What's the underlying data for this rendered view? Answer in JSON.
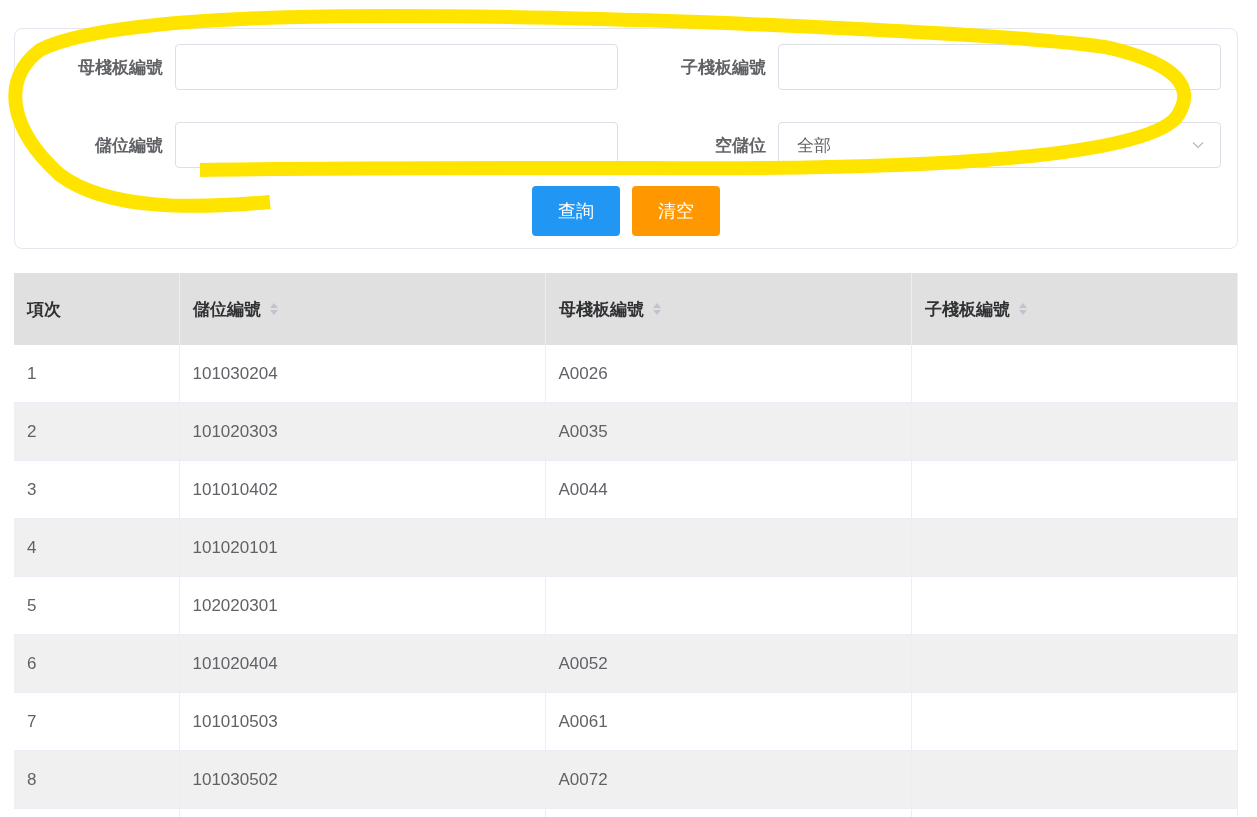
{
  "filters": [
    {
      "label": "母棧板編號",
      "kind": "text"
    },
    {
      "label": "子棧板編號",
      "kind": "text"
    },
    {
      "label": "儲位編號",
      "kind": "text"
    },
    {
      "label": "空儲位",
      "kind": "select",
      "value": "全部"
    }
  ],
  "buttons": [
    {
      "label": "查詢",
      "kind": "primary"
    },
    {
      "label": "清空",
      "kind": "warning"
    }
  ],
  "table": {
    "columns": [
      {
        "label": "項次",
        "sortable": false
      },
      {
        "label": "儲位編號",
        "sortable": true
      },
      {
        "label": "母棧板編號",
        "sortable": true
      },
      {
        "label": "子棧板編號",
        "sortable": true
      }
    ],
    "rows": [
      [
        "1",
        "101030204",
        "A0026",
        ""
      ],
      [
        "2",
        "101020303",
        "A0035",
        ""
      ],
      [
        "3",
        "101010402",
        "A0044",
        ""
      ],
      [
        "4",
        "101020101",
        "",
        ""
      ],
      [
        "5",
        "102020301",
        "",
        ""
      ],
      [
        "6",
        "101020404",
        "A0052",
        ""
      ],
      [
        "7",
        "101010503",
        "A0061",
        ""
      ],
      [
        "8",
        "101030502",
        "A0072",
        ""
      ],
      [
        "",
        "",
        "",
        ""
      ]
    ]
  }
}
